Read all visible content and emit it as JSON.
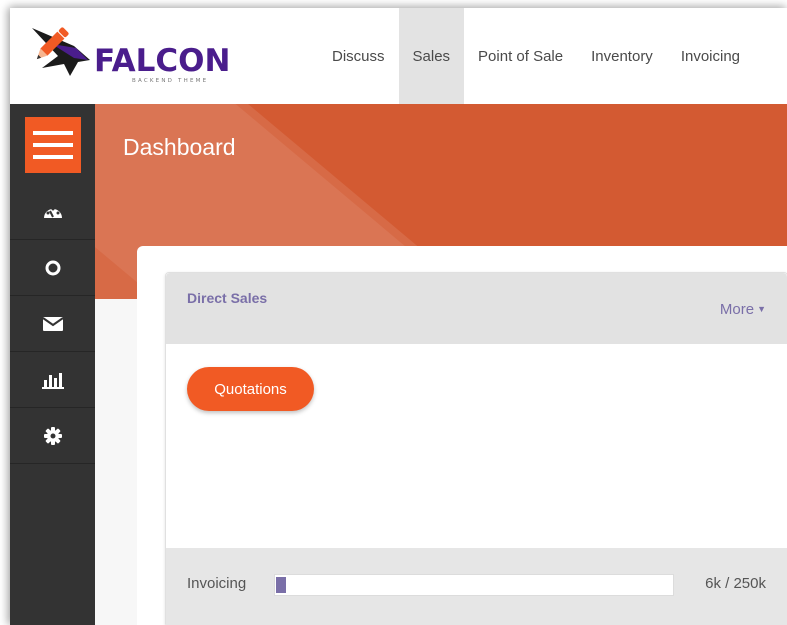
{
  "app": {
    "logo_text": "FALCON",
    "logo_subtext": "BACKEND THEME"
  },
  "nav": {
    "items": [
      {
        "label": "Discuss",
        "active": false
      },
      {
        "label": "Sales",
        "active": true
      },
      {
        "label": "Point of Sale",
        "active": false
      },
      {
        "label": "Inventory",
        "active": false
      },
      {
        "label": "Invoicing",
        "active": false
      }
    ]
  },
  "sidebar": {
    "menu_icon": "hamburger-menu-icon",
    "items": [
      {
        "icon": "dashboard-gauge-icon"
      },
      {
        "icon": "circle-icon"
      },
      {
        "icon": "envelope-icon"
      },
      {
        "icon": "bar-chart-icon"
      },
      {
        "icon": "gear-icon"
      }
    ]
  },
  "page": {
    "title": "Dashboard"
  },
  "sales_card": {
    "title": "Direct Sales",
    "more_label": "More",
    "quotations_button": "Quotations",
    "footer": {
      "label": "Invoicing",
      "value_text": "6k / 250k",
      "progress_fraction": 0.024
    }
  },
  "colors": {
    "accent": "#f15a24",
    "banner": "#d35a32",
    "sidebar": "#333333",
    "brand_purple": "#4a1d8c",
    "card_title": "#7a6fa8"
  }
}
